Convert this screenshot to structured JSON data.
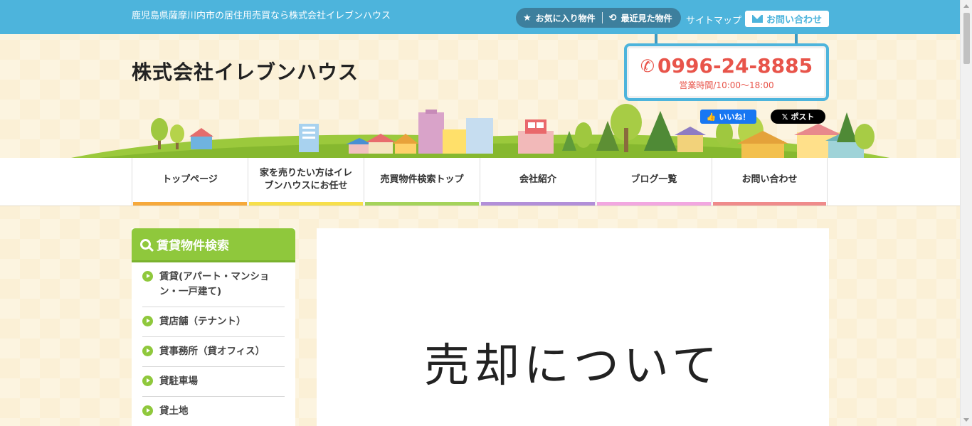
{
  "topbar": {
    "tagline": "鹿児島県薩摩川内市の居住用売買なら株式会社イレブンハウス",
    "favorites_label": "お気に入り物件",
    "recent_label": "最近見た物件",
    "sitemap_label": "サイトマップ",
    "contact_label": "お問い合わせ"
  },
  "header": {
    "logo_text": "株式会社イレブンハウス",
    "phone": "0996-24-8885",
    "hours": "営業時間/10:00～18:00",
    "fb_like_label": "いいね！",
    "x_post_label": "ポスト"
  },
  "nav": {
    "items": [
      {
        "label": "トップページ",
        "color": "#f6a93b"
      },
      {
        "label": "家を売りたい方はイレブンハウスにお任せ",
        "color": "#f7df4a"
      },
      {
        "label": "売買物件検索トップ",
        "color": "#a5d35a"
      },
      {
        "label": "会社紹介",
        "color": "#b28fd8"
      },
      {
        "label": "ブログ一覧",
        "color": "#f2a7e0"
      },
      {
        "label": "お問い合わせ",
        "color": "#ef8b8b"
      }
    ]
  },
  "sidebar": {
    "title": "賃貸物件検索",
    "items": [
      {
        "label": "賃貸(アパート・マンション・一戸建て)"
      },
      {
        "label": "貸店舗（テナント）"
      },
      {
        "label": "貸事務所（貸オフィス）"
      },
      {
        "label": "貸駐車場"
      },
      {
        "label": "貸土地"
      }
    ]
  },
  "main": {
    "title": "売却について"
  }
}
